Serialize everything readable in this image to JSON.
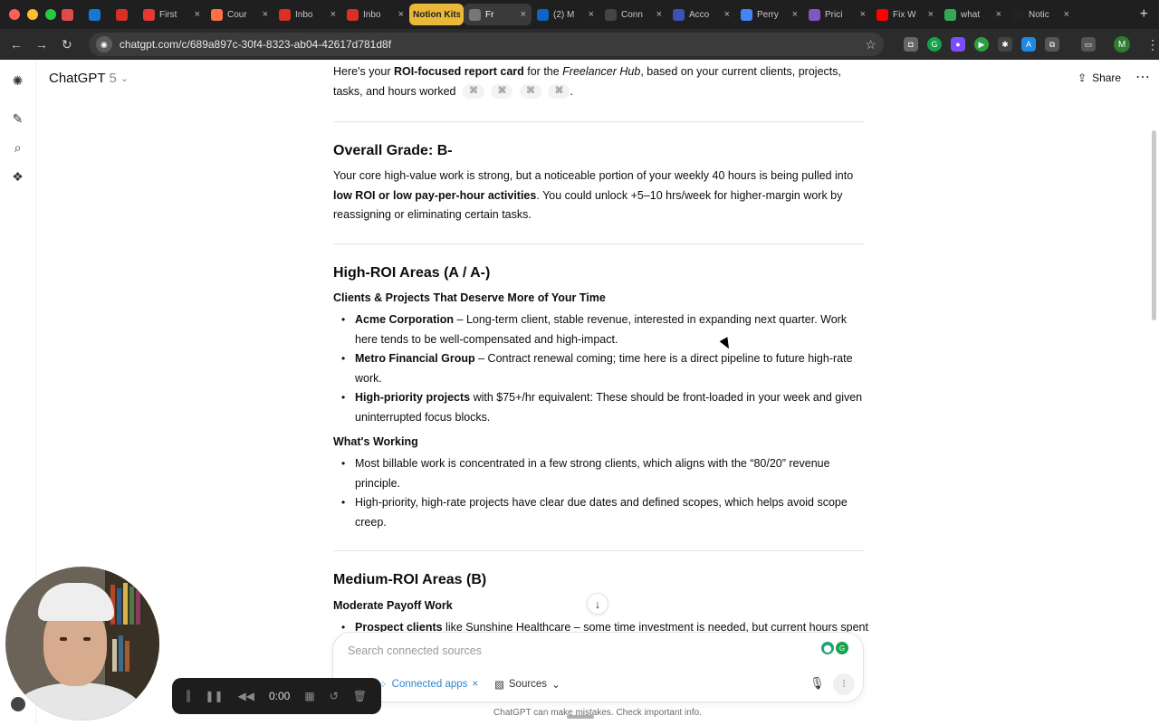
{
  "browser": {
    "tabs": [
      {
        "label": "",
        "icon": "record-icon",
        "color": "#e24a4a"
      },
      {
        "label": "",
        "icon": "outlook-icon",
        "color": "#1976d2"
      },
      {
        "label": "",
        "icon": "gmail-icon",
        "color": "#d93025"
      },
      {
        "label": "First",
        "icon": "target-icon",
        "color": "#e53935"
      },
      {
        "label": "Cour",
        "icon": "course-icon",
        "color": "#ff7043"
      },
      {
        "label": "Inbo",
        "icon": "gmail-icon",
        "color": "#d93025"
      },
      {
        "label": "Inbo",
        "icon": "gmail-icon",
        "color": "#d93025"
      },
      {
        "label": "Notion Kits",
        "icon": "group",
        "color": "#e9b83a"
      },
      {
        "label": "Fr",
        "icon": "chatgpt-icon",
        "color": "#777777",
        "active": true
      },
      {
        "label": "(2) M",
        "icon": "linkedin-icon",
        "color": "#0a66c2"
      },
      {
        "label": "Conn",
        "icon": "chatgpt-icon",
        "color": "#444444"
      },
      {
        "label": "Acco",
        "icon": "key-icon",
        "color": "#3f51b5"
      },
      {
        "label": "Perry",
        "icon": "docs-icon",
        "color": "#4285f4"
      },
      {
        "label": "Prici",
        "icon": "pricing-icon",
        "color": "#7e57c2"
      },
      {
        "label": "Fix W",
        "icon": "youtube-icon",
        "color": "#ff0000"
      },
      {
        "label": "what",
        "icon": "google-icon",
        "color": "#34a853"
      },
      {
        "label": "Notic",
        "icon": "notion-icon",
        "color": "#222222"
      }
    ],
    "url": "chatgpt.com/c/689a897c-30f4-8323-ab04-42617d781d8f"
  },
  "app": {
    "model_name": "ChatGPT",
    "model_version": "5",
    "share_label": "Share"
  },
  "message": {
    "intro": {
      "pre": "Here's your ",
      "bold": "ROI-focused report card",
      "mid": " for the ",
      "italic": "Freelancer Hub",
      "post": ", based on your current clients, projects, tasks, and hours worked",
      "citation_glyph": "⌘"
    },
    "overall": {
      "heading": "Overall Grade: B-",
      "p1": "Your core high-value work is strong, but a noticeable portion of your weekly 40 hours is being pulled into ",
      "bold": "low ROI or low pay-per-hour activities",
      "p2": ". You could unlock +5–10 hrs/week for higher-margin work by reassigning or eliminating certain tasks."
    },
    "high_roi": {
      "heading": "High-ROI Areas (A / A-)",
      "subheading": "Clients & Projects That Deserve More of Your Time",
      "items": [
        {
          "bold": "Acme Corporation",
          "text": " – Long-term client, stable revenue, interested in expanding next quarter. Work here tends to be well-compensated and high-impact."
        },
        {
          "bold": "Metro Financial Group",
          "text": " – Contract renewal coming; time here is a direct pipeline to future high-rate work."
        },
        {
          "bold": "High-priority projects",
          "text": " with $75+/hr equivalent: These should be front-loaded in your week and given uninterrupted focus blocks."
        }
      ],
      "working_heading": "What's Working",
      "working_items": [
        "Most billable work is concentrated in a few strong clients, which aligns with the “80/20” revenue principle.",
        "High-priority, high-rate projects have clear due dates and defined scopes, which helps avoid scope creep."
      ]
    },
    "medium_roi": {
      "heading": "Medium-ROI Areas (B)",
      "subheading": "Moderate Payoff Work",
      "item_bold": "Prospect clients",
      "item_text": " like Sunshine Healthcare – some time investment is needed, but current hours spent"
    }
  },
  "composer": {
    "placeholder": "Search connected sources",
    "connected_apps_label": "Connected apps",
    "sources_label": "Sources",
    "disclaimer": "ChatGPT can make mistakes. Check important info."
  },
  "recorder": {
    "time": "0:00"
  },
  "colors": {
    "link_blue": "#2b87d3",
    "tab_group_notion": "#e9b83a",
    "chrome_dark": "#1f1f1f"
  }
}
